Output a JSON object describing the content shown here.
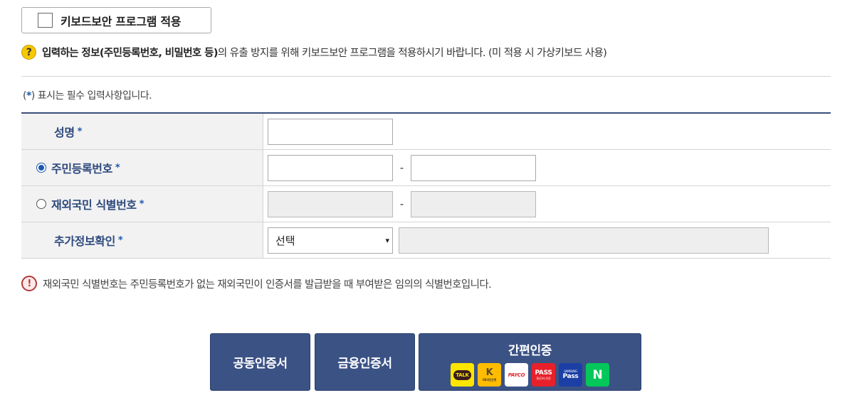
{
  "keyboard_security": {
    "toggle_label": "키보드보안 프로그램 적용",
    "checked": false,
    "notice_prefix": "입력하는 정보(주민등록번호, 비밀번호 등)",
    "notice_rest": "의 유출 방지를 위해 키보드보안 프로그램을 적용하시기 바랍니다. (미 적용 시 가상키보드 사용)"
  },
  "required_note": {
    "open": "(",
    "star": "*",
    "text": ") 표시는 필수 입력사항입니다."
  },
  "form": {
    "rows": [
      {
        "label": "성명",
        "star": "*"
      },
      {
        "label": "주민등록번호",
        "star": "*",
        "selected": true
      },
      {
        "label": "재외국민 식별번호",
        "star": "*",
        "selected": false
      },
      {
        "label": "추가정보확인",
        "star": "*"
      }
    ],
    "dash": "-",
    "select_value": "선택",
    "select_arrow": "▾"
  },
  "warning": {
    "icon": "!",
    "text": "재외국민 식별번호는 주민등록번호가 없는 재외국민이 인증서를 발급받을 때 부여받은 임의의 식별번호입니다."
  },
  "buttons": {
    "joint_cert": "공동인증서",
    "financial_cert": "금융인증서",
    "simple_auth": "간편인증"
  },
  "providers": [
    {
      "name": "kakaotalk",
      "text": "TALK"
    },
    {
      "name": "kb",
      "text": "K",
      "sub": "KB국민은행"
    },
    {
      "name": "payco",
      "text": "PAYCO"
    },
    {
      "name": "pass",
      "text": "PASS",
      "sub": "통신3사 인증"
    },
    {
      "name": "samsung-pass",
      "text": "Pass",
      "sub": "SAMSUNG"
    },
    {
      "name": "naver",
      "text": "N"
    }
  ],
  "colors": {
    "primary_button": "#3b5285",
    "label_text": "#2f4a7e",
    "required_star": "#1d57b0",
    "table_header_bg": "#f2f2f2"
  }
}
